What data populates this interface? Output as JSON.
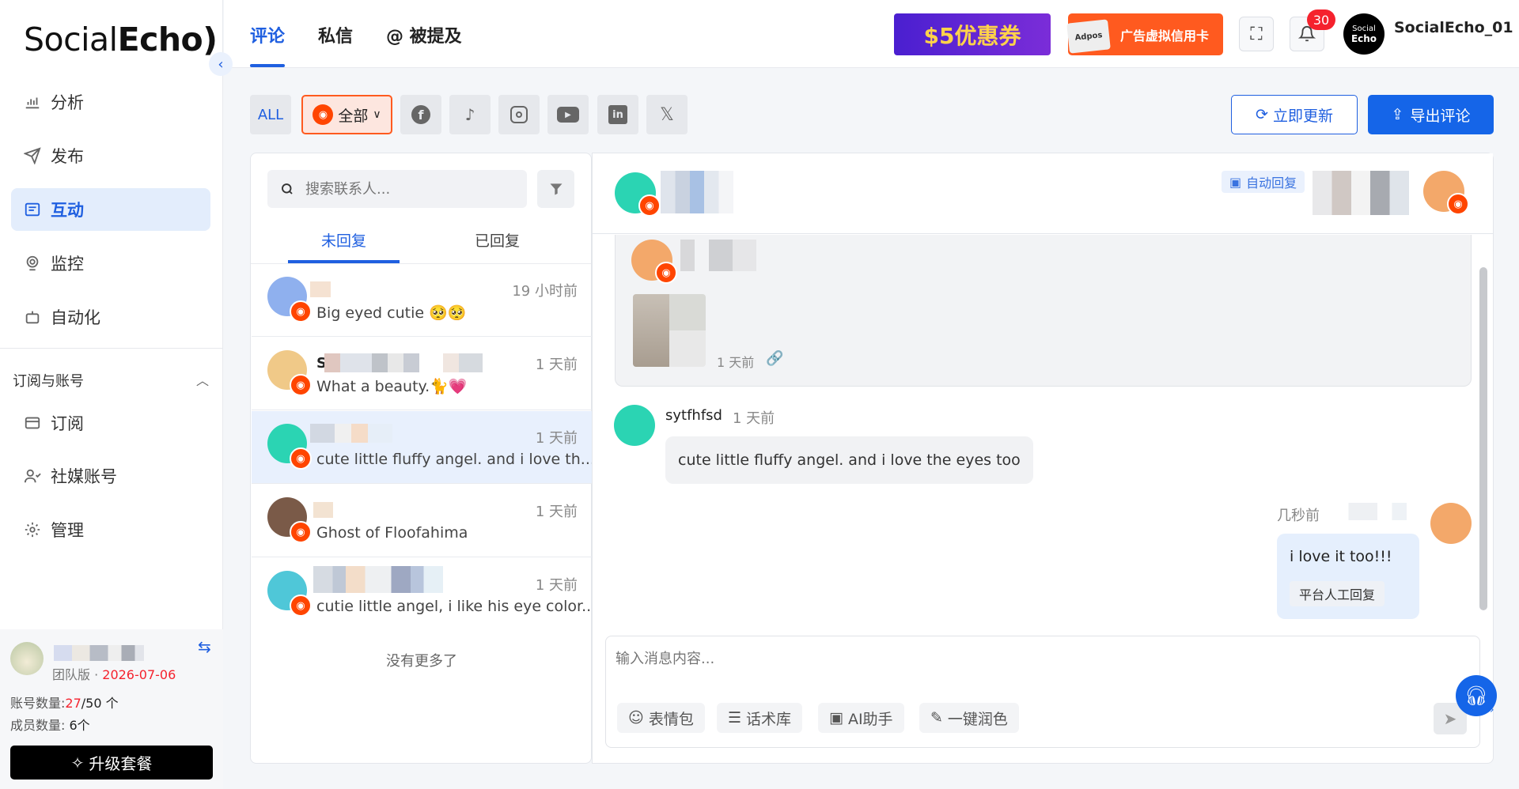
{
  "brand": {
    "logo_pre": "Social",
    "logo_bold": "Echo"
  },
  "sidebar": {
    "items": [
      {
        "label": "分析",
        "icon": "chart-icon"
      },
      {
        "label": "发布",
        "icon": "send-icon"
      },
      {
        "label": "互动",
        "icon": "message-icon"
      },
      {
        "label": "监控",
        "icon": "monitor-icon"
      },
      {
        "label": "自动化",
        "icon": "robot-icon"
      }
    ],
    "section": "订阅与账号",
    "sub_items": [
      {
        "label": "订阅",
        "icon": "card-icon"
      },
      {
        "label": "社媒账号",
        "icon": "users-icon"
      },
      {
        "label": "管理",
        "icon": "gear-icon"
      }
    ],
    "account": {
      "plan": "团队版 · ",
      "expiry": "2026-07-06",
      "accounts_label": "账号数量:",
      "accounts_used": "27",
      "accounts_total": "/50 个",
      "members_label": "成员数量:",
      "members": "6个"
    },
    "upgrade": "升级套餐"
  },
  "topbar": {
    "tabs": [
      "评论",
      "私信",
      "@ 被提及"
    ],
    "promo1": "$5优惠券",
    "promo2": "广告虚拟信用卡",
    "promo2_card": "Adpos",
    "notifications": "30",
    "username": "SocialEcho_01",
    "avatar_text1": "Social",
    "avatar_text2": "Echo"
  },
  "filters": {
    "all": "ALL",
    "selected": "全部",
    "refresh": "立即更新",
    "export": "导出评论"
  },
  "list": {
    "search_placeholder": "搜索联系人...",
    "tabs": [
      "未回复",
      "已回复"
    ],
    "items": [
      {
        "time": "19 小时前",
        "text": "Big eyed cutie 🥺🥺",
        "initial": ""
      },
      {
        "time": "1 天前",
        "text": "What a beauty.🐈💗",
        "initial": "S"
      },
      {
        "time": "1 天前",
        "text": "cute little fluffy angel. and i love th...",
        "initial": ""
      },
      {
        "time": "1 天前",
        "text": "Ghost of Floofahima",
        "initial": ""
      },
      {
        "time": "1 天前",
        "text": "cutie little angel, i like his eye color...",
        "initial": ""
      }
    ],
    "no_more": "没有更多了"
  },
  "chat": {
    "auto_reply": "自动回复",
    "post_time": "1 天前",
    "comment_user": "sytfhfsd",
    "comment_time": "1 天前",
    "comment_text": "cute little fluffy angel. and i love the eyes too",
    "reply_time": "几秒前",
    "reply_text": "i love it too!!!",
    "reply_tag": "平台人工回复",
    "input_placeholder": "输入消息内容...",
    "tools": [
      "表情包",
      "话术库",
      "AI助手",
      "一键润色"
    ]
  },
  "colors": {
    "accent": "#1f5fe0",
    "reddit": "#ff4500",
    "badge": "#f5222d"
  }
}
